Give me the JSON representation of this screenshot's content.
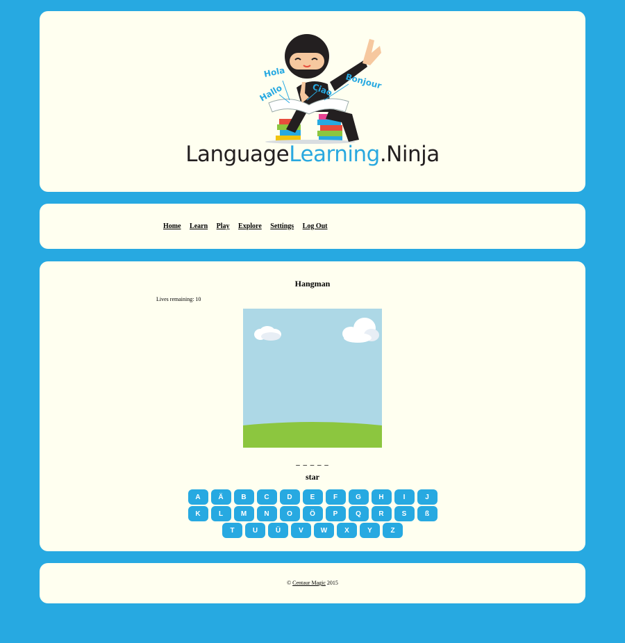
{
  "header": {
    "logo": {
      "brand_part1": "Language",
      "brand_part2": "Learning",
      "brand_part3": ".Ninja",
      "speech_words": [
        "Hola",
        "Hallo",
        "Ciao",
        "Bonjour"
      ]
    }
  },
  "nav": {
    "items": [
      "Home",
      "Learn",
      "Play",
      "Explore",
      "Settings",
      "Log Out"
    ]
  },
  "game": {
    "title": "Hangman",
    "lives_text": "Lives remaining: 10",
    "blanks": "_ _ _ _ _",
    "hint": "star",
    "keyboard_rows": [
      [
        "A",
        "Ä",
        "B",
        "C",
        "D",
        "E",
        "F",
        "G",
        "H",
        "I",
        "J"
      ],
      [
        "K",
        "L",
        "M",
        "N",
        "O",
        "Ö",
        "P",
        "Q",
        "R",
        "S",
        "ß"
      ],
      [
        "T",
        "U",
        "Ü",
        "V",
        "W",
        "X",
        "Y",
        "Z"
      ]
    ]
  },
  "footer": {
    "copyright_symbol": "©",
    "company": "Centaur Magic",
    "year": "2015"
  },
  "colors": {
    "background": "#27a9e1",
    "panel": "#fffff0",
    "key": "#27a9e1",
    "sky": "#add8e6",
    "grass": "#8cc63f"
  }
}
